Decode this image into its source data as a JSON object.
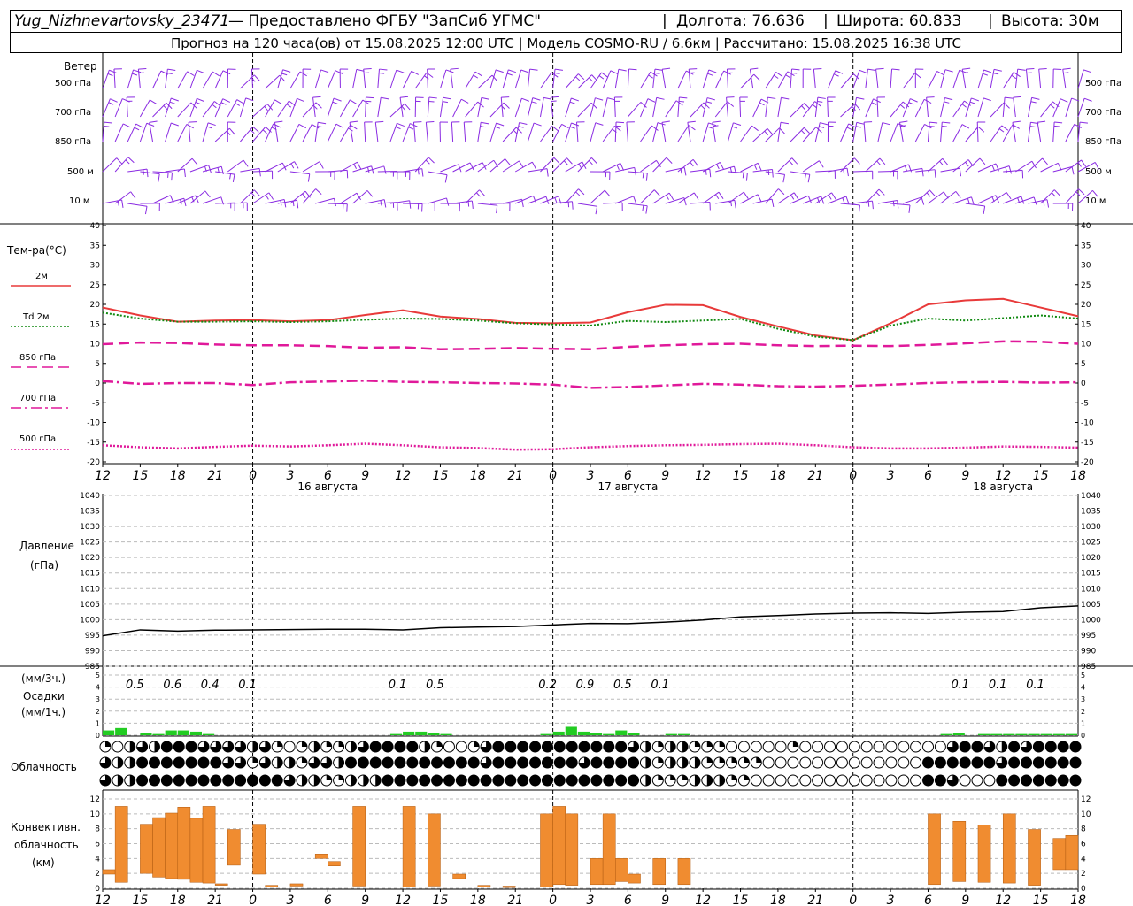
{
  "header": {
    "station": "Yug_Nizhnevartovsky_23471",
    "provider": "— Предоставлено ФГБУ \"ЗапСиб УГМС\"",
    "longitude": "Долгота: 76.636",
    "latitude": "Широта: 60.833",
    "altitude": "Высота: 30м",
    "forecast": "Прогноз на 120 часа(ов) от 15.08.2025 12:00 UTC",
    "model": "Модель COSMO-RU / 6.6км",
    "computed": "Рассчитано: 15.08.2025 16:38 UTC"
  },
  "wind_panel": {
    "title": "Ветер",
    "levels": [
      "500 гПа",
      "700 гПа",
      "850 гПа",
      "500 м",
      "10  м"
    ],
    "color": "#8a2be2"
  },
  "temp_panel": {
    "title": "Тем-ра(°C)",
    "legend": [
      "2м",
      "Td  2м",
      "850 гПа",
      "700 гПа",
      "500 гПа"
    ]
  },
  "pressure_panel": {
    "title1": "Давление",
    "title2": "(гПа)"
  },
  "precip_panel": {
    "unit3": "(мм/3ч.)",
    "title": "Осадки",
    "unit1": "(мм/1ч.)",
    "labels": [
      {
        "h": 3,
        "t": "0.5"
      },
      {
        "h": 6,
        "t": "0.6"
      },
      {
        "h": 9,
        "t": "0.4"
      },
      {
        "h": 12,
        "t": "0.1"
      },
      {
        "h": 24,
        "t": "0.1"
      },
      {
        "h": 27,
        "t": "0.5"
      },
      {
        "h": 36,
        "t": "0.2"
      },
      {
        "h": 39,
        "t": "0.9"
      },
      {
        "h": 42,
        "t": "0.5"
      },
      {
        "h": 45,
        "t": "0.1"
      },
      {
        "h": 69,
        "t": "0.1"
      },
      {
        "h": 72,
        "t": "0.1"
      },
      {
        "h": 75,
        "t": "0.1"
      }
    ]
  },
  "cloud_panel": {
    "title": "Облачность"
  },
  "conv_panel": {
    "title1": "Конвективн.",
    "title2": "облачность",
    "title3": "(км)"
  },
  "time_axis": {
    "ticks": [
      "12",
      "15",
      "18",
      "21",
      "0",
      "3",
      "6",
      "9",
      "12",
      "15",
      "18",
      "21",
      "0",
      "3",
      "6",
      "9",
      "12",
      "15",
      "18",
      "21",
      "0",
      "3",
      "6",
      "9",
      "12",
      "15",
      "18"
    ],
    "days": [
      "16 августа",
      "17 августа",
      "18 августа"
    ]
  },
  "chart_data": [
    {
      "type": "line",
      "title": "Тем-ра(°C)",
      "ylim": [
        -20,
        40
      ],
      "x_hours": [
        0,
        3,
        6,
        9,
        12,
        15,
        18,
        21,
        24,
        27,
        30,
        33,
        36,
        39,
        42,
        45,
        48,
        51,
        54,
        57,
        60,
        63,
        66,
        69,
        72,
        75,
        78
      ],
      "series": [
        {
          "name": "2м",
          "color": "#e83a3a",
          "style": "solid",
          "values": [
            19.2,
            17.2,
            15.6,
            15.9,
            16.0,
            15.7,
            16.0,
            17.3,
            18.5,
            16.9,
            16.3,
            15.3,
            15.2,
            15.4,
            18.0,
            19.9,
            19.8,
            16.8,
            14.4,
            12.1,
            10.9,
            15.2,
            20.0,
            21.0,
            21.4,
            19.2,
            17.0
          ]
        },
        {
          "name": "Td 2м",
          "color": "#118a11",
          "style": "dotted",
          "values": [
            17.9,
            16.4,
            15.6,
            15.6,
            15.7,
            15.5,
            15.7,
            16.1,
            16.4,
            16.3,
            15.9,
            15.2,
            14.9,
            14.6,
            15.8,
            15.5,
            15.9,
            16.3,
            13.8,
            11.8,
            10.9,
            14.6,
            16.4,
            15.9,
            16.5,
            17.2,
            16.4
          ]
        },
        {
          "name": "850 гПа",
          "color": "#e0199a",
          "style": "dash",
          "values": [
            9.9,
            10.3,
            10.2,
            9.8,
            9.6,
            9.6,
            9.4,
            9.0,
            9.1,
            8.6,
            8.7,
            8.9,
            8.7,
            8.6,
            9.2,
            9.6,
            9.9,
            10.0,
            9.6,
            9.4,
            9.5,
            9.4,
            9.7,
            10.1,
            10.6,
            10.5,
            10.0
          ]
        },
        {
          "name": "700 гПа",
          "color": "#e0199a",
          "style": "dashdot",
          "values": [
            0.5,
            -0.2,
            0.0,
            0.0,
            -0.5,
            0.2,
            0.4,
            0.6,
            0.3,
            0.2,
            0.0,
            -0.1,
            -0.4,
            -1.2,
            -1.0,
            -0.6,
            -0.2,
            -0.4,
            -0.8,
            -0.9,
            -0.7,
            -0.4,
            0.0,
            0.2,
            0.3,
            0.1,
            0.2
          ]
        },
        {
          "name": "500 гПа",
          "color": "#e0199a",
          "style": "dotted",
          "values": [
            -15.8,
            -16.3,
            -16.6,
            -16.2,
            -15.9,
            -16.1,
            -15.8,
            -15.4,
            -15.8,
            -16.3,
            -16.5,
            -16.9,
            -16.8,
            -16.3,
            -16.0,
            -15.8,
            -15.7,
            -15.5,
            -15.4,
            -15.8,
            -16.3,
            -16.6,
            -16.6,
            -16.4,
            -16.1,
            -16.2,
            -16.4
          ]
        }
      ]
    },
    {
      "type": "line",
      "title": "Давление (гПа)",
      "ylim": [
        985,
        1040
      ],
      "x_hours": [
        0,
        3,
        6,
        9,
        12,
        15,
        18,
        21,
        24,
        27,
        30,
        33,
        36,
        39,
        42,
        45,
        48,
        51,
        54,
        57,
        60,
        63,
        66,
        69,
        72,
        75,
        78
      ],
      "series": [
        {
          "name": "Давление",
          "color": "#000000",
          "values": [
            994.8,
            996.7,
            996.3,
            996.6,
            996.7,
            996.8,
            996.9,
            996.9,
            996.7,
            997.4,
            997.6,
            997.8,
            998.3,
            998.8,
            998.7,
            999.2,
            999.9,
            1000.9,
            1001.3,
            1001.8,
            1002.1,
            1002.2,
            1002.0,
            1002.4,
            1002.6,
            1003.8,
            1004.4
          ]
        }
      ]
    },
    {
      "type": "bar",
      "title": "Осадки (мм/1ч.)",
      "ylim": [
        0,
        5
      ],
      "x_hours": [
        0,
        1,
        3,
        4,
        5,
        6,
        7,
        8,
        23,
        24,
        25,
        26,
        27,
        35,
        36,
        37,
        38,
        39,
        40,
        41,
        42,
        45,
        46,
        67,
        68,
        70,
        71,
        72,
        73,
        74,
        75,
        76,
        77
      ],
      "values": [
        0.4,
        0.6,
        0.2,
        0.1,
        0.4,
        0.4,
        0.3,
        0.1,
        0.1,
        0.3,
        0.3,
        0.2,
        0.1,
        0.1,
        0.3,
        0.7,
        0.3,
        0.2,
        0.1,
        0.4,
        0.2,
        0.1,
        0.1,
        0.1,
        0.2,
        0.1,
        0.1,
        0.1,
        0.1,
        0.1,
        0.1,
        0.1,
        0.1
      ],
      "color": "#22cc22"
    },
    {
      "type": "bar",
      "title": "Конвективн. облачность (км)",
      "ylim": [
        0,
        12
      ],
      "bars": [
        {
          "h": 0,
          "bot": 1.9,
          "top": 2.5
        },
        {
          "h": 1,
          "bot": 0.8,
          "top": 11.0
        },
        {
          "h": 3,
          "bot": 2.0,
          "top": 8.6
        },
        {
          "h": 4,
          "bot": 1.5,
          "top": 9.5
        },
        {
          "h": 5,
          "bot": 1.3,
          "top": 10.1
        },
        {
          "h": 6,
          "bot": 1.2,
          "top": 10.9
        },
        {
          "h": 7,
          "bot": 0.8,
          "top": 9.4
        },
        {
          "h": 8,
          "bot": 0.7,
          "top": 11.0
        },
        {
          "h": 9,
          "bot": 0.4,
          "top": 0.6
        },
        {
          "h": 10,
          "bot": 3.1,
          "top": 7.9
        },
        {
          "h": 12,
          "bot": 1.9,
          "top": 8.6
        },
        {
          "h": 13,
          "bot": 0.2,
          "top": 0.4
        },
        {
          "h": 15,
          "bot": 0.3,
          "top": 0.6
        },
        {
          "h": 17,
          "bot": 4.0,
          "top": 4.6
        },
        {
          "h": 18,
          "bot": 3.0,
          "top": 3.6
        },
        {
          "h": 20,
          "bot": 0.3,
          "top": 11.0
        },
        {
          "h": 24,
          "bot": 0.2,
          "top": 11.0
        },
        {
          "h": 26,
          "bot": 0.3,
          "top": 10.0
        },
        {
          "h": 28,
          "bot": 1.3,
          "top": 1.9
        },
        {
          "h": 30,
          "bot": 0.2,
          "top": 0.4
        },
        {
          "h": 32,
          "bot": 0.1,
          "top": 0.3
        },
        {
          "h": 35,
          "bot": 0.2,
          "top": 10.0
        },
        {
          "h": 36,
          "bot": 0.5,
          "top": 11.0
        },
        {
          "h": 37,
          "bot": 0.4,
          "top": 10.0
        },
        {
          "h": 39,
          "bot": 0.5,
          "top": 4.0
        },
        {
          "h": 40,
          "bot": 0.5,
          "top": 10.0
        },
        {
          "h": 41,
          "bot": 0.9,
          "top": 4.0
        },
        {
          "h": 42,
          "bot": 0.7,
          "top": 1.9
        },
        {
          "h": 44,
          "bot": 0.5,
          "top": 4.0
        },
        {
          "h": 46,
          "bot": 0.5,
          "top": 4.0
        },
        {
          "h": 66,
          "bot": 0.5,
          "top": 10.0
        },
        {
          "h": 68,
          "bot": 0.9,
          "top": 9.0
        },
        {
          "h": 70,
          "bot": 0.8,
          "top": 8.5
        },
        {
          "h": 72,
          "bot": 0.7,
          "top": 10.0
        },
        {
          "h": 74,
          "bot": 0.4,
          "top": 7.9
        },
        {
          "h": 76,
          "bot": 2.5,
          "top": 6.7
        },
        {
          "h": 77,
          "bot": 2.5,
          "top": 7.1
        }
      ],
      "color": "#f08c30"
    }
  ],
  "clouds": {
    "count": 80,
    "low": "10232444333323101211234444210013444444444443212211100000100000000000034432434444444",
    "mid": "32244444443313221332444444444443444444434444212221111100000000000004444443444444",
    "high": "32244444444444432211222444444444444444444444211122211000000000000004430004444444"
  }
}
